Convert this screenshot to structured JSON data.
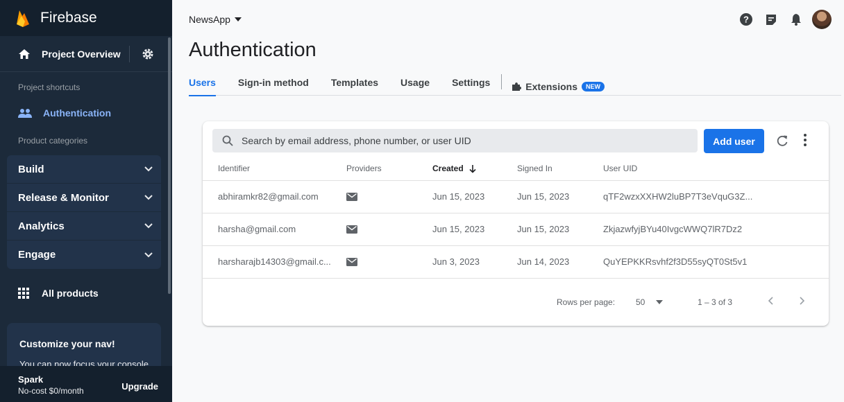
{
  "sidebar": {
    "brand": "Firebase",
    "overview_label": "Project Overview",
    "shortcuts_label": "Project shortcuts",
    "shortcut_auth": "Authentication",
    "categories_label": "Product categories",
    "categories": [
      "Build",
      "Release & Monitor",
      "Analytics",
      "Engage"
    ],
    "all_products": "All products",
    "customize_title": "Customize your nav!",
    "customize_text": "You can now focus your console",
    "plan_name": "Spark",
    "plan_sub": "No-cost $0/month",
    "upgrade": "Upgrade"
  },
  "header": {
    "project": "NewsApp",
    "title": "Authentication",
    "tabs": [
      "Users",
      "Sign-in method",
      "Templates",
      "Usage",
      "Settings"
    ],
    "extensions_label": "Extensions",
    "extensions_badge": "NEW"
  },
  "users": {
    "search_placeholder": "Search by email address, phone number, or user UID",
    "add_user": "Add user",
    "columns": [
      "Identifier",
      "Providers",
      "Created",
      "Signed In",
      "User UID"
    ],
    "rows": [
      {
        "identifier": "abhiramkr82@gmail.com",
        "created": "Jun 15, 2023",
        "signed_in": "Jun 15, 2023",
        "uid": "qTF2wzxXXHW2luBP7T3eVquG3Z..."
      },
      {
        "identifier": "harsha@gmail.com",
        "created": "Jun 15, 2023",
        "signed_in": "Jun 15, 2023",
        "uid": "ZkjazwfyjBYu40IvgcWWQ7lR7Dz2"
      },
      {
        "identifier": "harsharajb14303@gmail.c...",
        "created": "Jun 3, 2023",
        "signed_in": "Jun 14, 2023",
        "uid": "QuYEPKKRsvhf2f3D55syQT0St5v1"
      }
    ],
    "rows_per_page_label": "Rows per page:",
    "rows_per_page": "50",
    "range": "1 – 3 of 3"
  },
  "colors": {
    "sidebar_bg": "#1c2a3a",
    "accent": "#1a73e8"
  }
}
